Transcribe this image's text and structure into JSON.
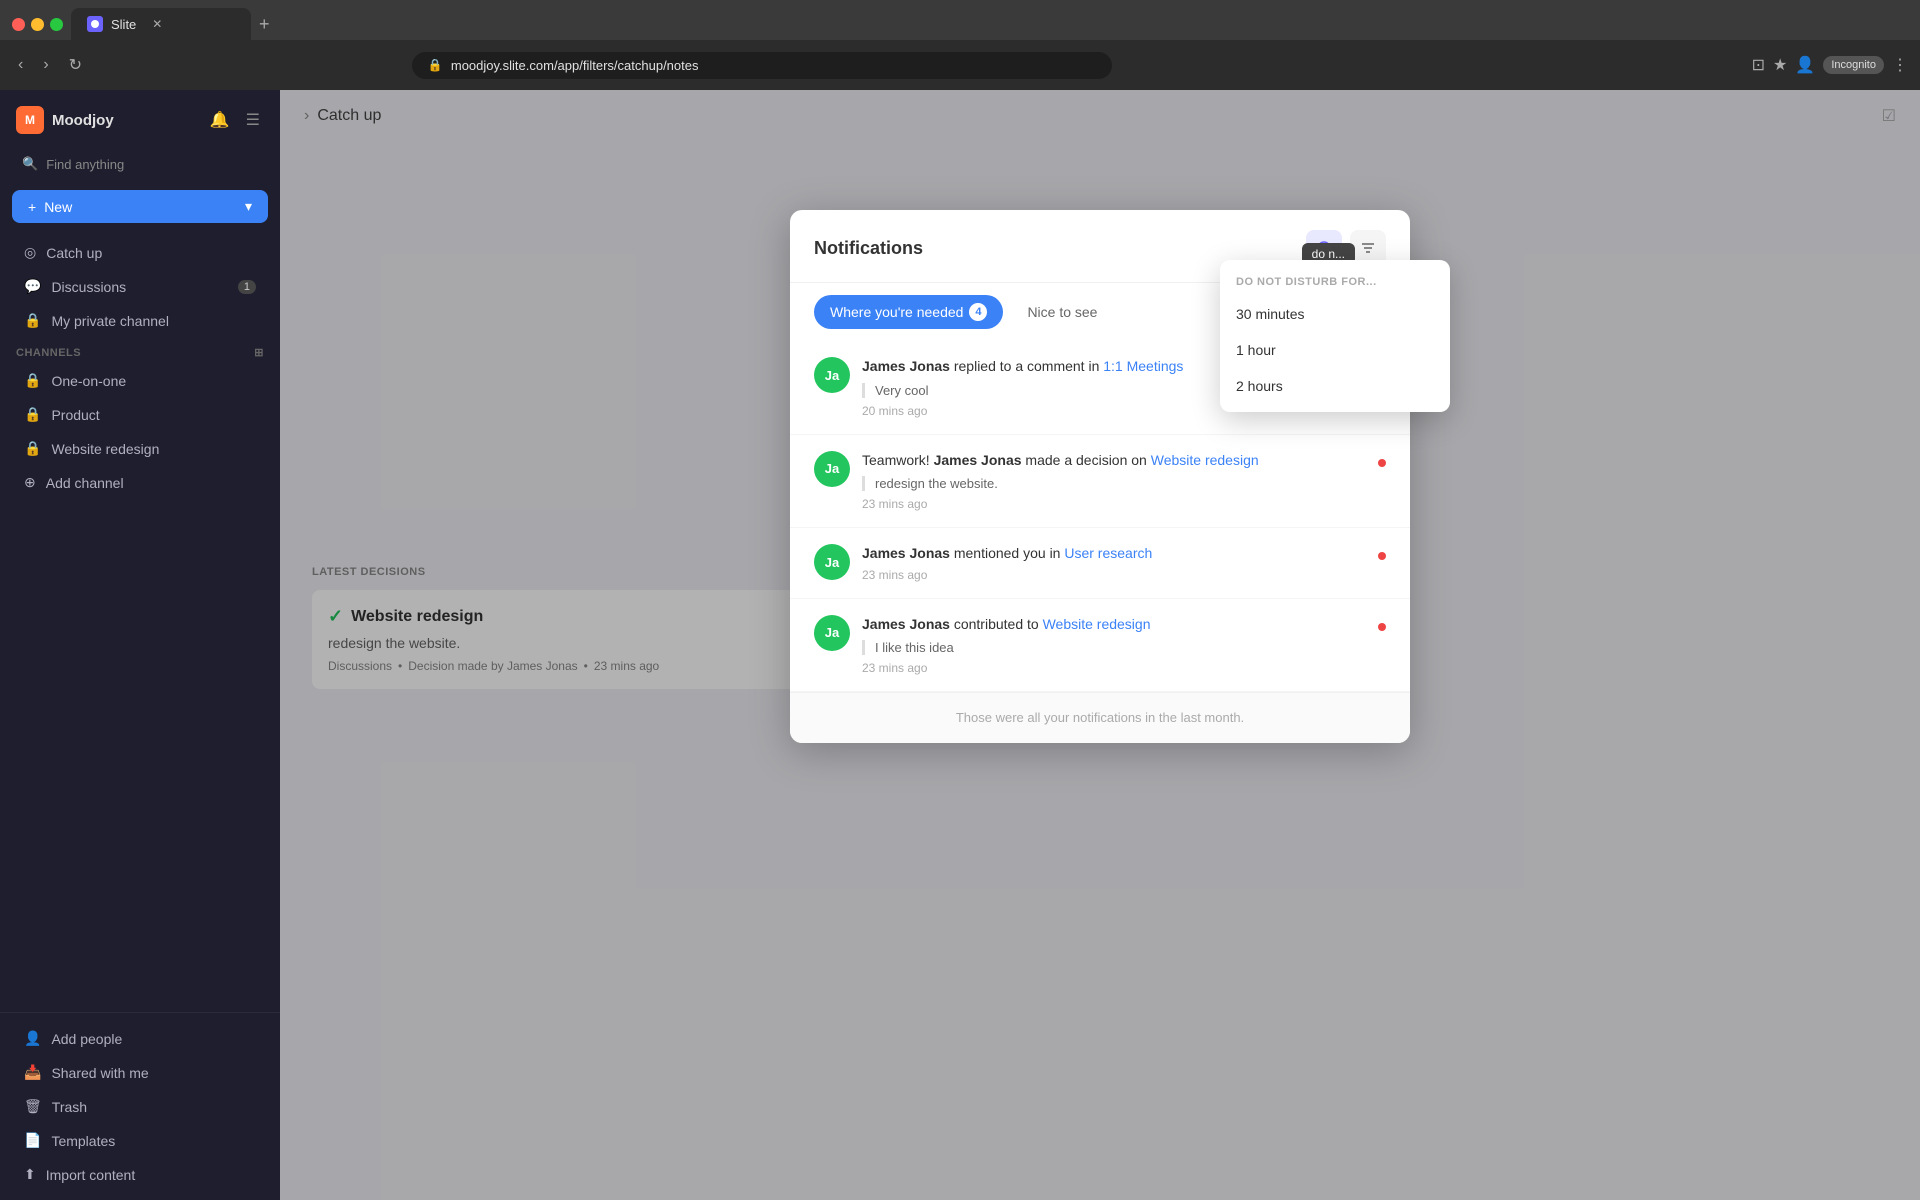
{
  "browser": {
    "tab_title": "Slite",
    "address": "moodjoy.slite.com/app/filters/catchup/notes",
    "incognito_label": "Incognito"
  },
  "sidebar": {
    "workspace_name": "Moodjoy",
    "workspace_initials": "M",
    "search_placeholder": "Find anything",
    "new_button_label": "New",
    "nav_items": [
      {
        "label": "Catch up",
        "icon": "◎",
        "count": null
      },
      {
        "label": "Discussions",
        "icon": "💬",
        "count": "1"
      },
      {
        "label": "My private channel",
        "icon": "🔒",
        "count": null
      }
    ],
    "channels_section": "Channels",
    "channels": [
      {
        "label": "One-on-one",
        "icon": "🔒"
      },
      {
        "label": "Product",
        "icon": "🔒"
      },
      {
        "label": "Website redesign",
        "icon": "🔒"
      },
      {
        "label": "Add channel",
        "icon": "⊕"
      }
    ],
    "bottom_items": [
      {
        "label": "Add people",
        "icon": "👤"
      },
      {
        "label": "Shared with me",
        "icon": "📥"
      },
      {
        "label": "Trash",
        "icon": "🗑"
      },
      {
        "label": "Templates",
        "icon": "📄"
      },
      {
        "label": "Import content",
        "icon": "⬆"
      }
    ]
  },
  "notifications": {
    "modal_title": "Notifications",
    "tab_where_needed": "Where you're needed",
    "tab_where_needed_count": "4",
    "tab_nice_to_see": "Nice to see",
    "items": [
      {
        "avatar_initials": "Ja",
        "text_prefix": "James Jonas",
        "text_action": "replied to a comment in",
        "text_link": "1:1 Meetings",
        "quote": "Very cool",
        "time": "20 mins ago",
        "unread": false
      },
      {
        "avatar_initials": "Ja",
        "text_prefix": "Teamwork! James Jonas",
        "text_action": "made a decision on",
        "text_link": "Website redesign",
        "quote": "redesign the website.",
        "time": "23 mins ago",
        "unread": true
      },
      {
        "avatar_initials": "Ja",
        "text_prefix": "James Jonas",
        "text_action": "mentioned you in",
        "text_link": "User research",
        "quote": null,
        "time": "23 mins ago",
        "unread": true
      },
      {
        "avatar_initials": "Ja",
        "text_prefix": "James Jonas",
        "text_action": "contributed to",
        "text_link": "Website redesign",
        "quote": "I like this idea",
        "time": "23 mins ago",
        "unread": true
      }
    ],
    "footer_text": "Those were all your notifications in the last month."
  },
  "dnd": {
    "tooltip_label": "do n...",
    "header": "DO NOT DISTURB FOR...",
    "options": [
      "30 minutes",
      "1 hour",
      "2 hours"
    ]
  },
  "main": {
    "catchup_label": "Catch up",
    "latest_decisions_label": "LATEST DECISIONS",
    "decision_title": "Website redesign",
    "decision_desc": "redesign the website.",
    "decision_channel": "Discussions",
    "decision_meta": "Decision made by James Jonas",
    "decision_time": "23 mins ago"
  }
}
